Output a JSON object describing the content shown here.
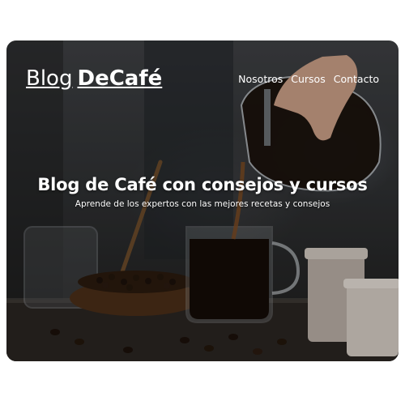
{
  "header": {
    "logo_part1": "Blog",
    "logo_part2": "DeCafé",
    "nav": [
      "Nosotros",
      "Cursos",
      "Contacto"
    ]
  },
  "hero": {
    "title": "Blog de Café con consejos y cursos",
    "subtitle": "Aprende de los expertos con las mejores recetas y consejos",
    "image": "coffee-pour-over-photo"
  },
  "colors": {
    "text": "#ffffff",
    "background_dark": "#2f3133",
    "coffee": "#1a120c"
  }
}
